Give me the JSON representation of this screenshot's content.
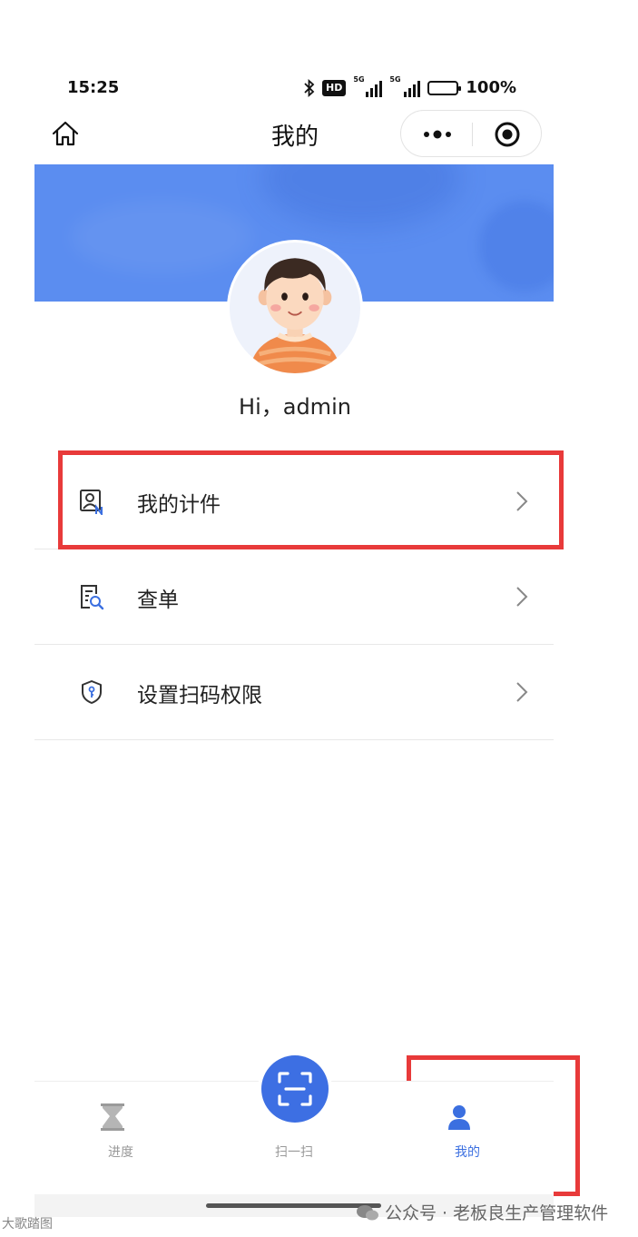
{
  "status_bar": {
    "time": "15:25",
    "hd": "HD",
    "signal1": "5G",
    "signal2": "5G",
    "battery": "100%"
  },
  "nav": {
    "title": "我的"
  },
  "profile": {
    "greeting": "Hi，admin"
  },
  "menu": [
    {
      "label": "我的计件",
      "icon": "piecework-icon"
    },
    {
      "label": "查单",
      "icon": "search-doc-icon"
    },
    {
      "label": "设置扫码权限",
      "icon": "shield-icon"
    }
  ],
  "tabbar": {
    "progress": "进度",
    "scan": "扫一扫",
    "mine": "我的"
  },
  "watermark": {
    "text": "公众号 · 老板良生产管理软件",
    "left": "大歌踏图"
  },
  "colors": {
    "accent": "#3d6fe3",
    "banner": "#5b8df0",
    "highlight": "#e83a3a"
  }
}
